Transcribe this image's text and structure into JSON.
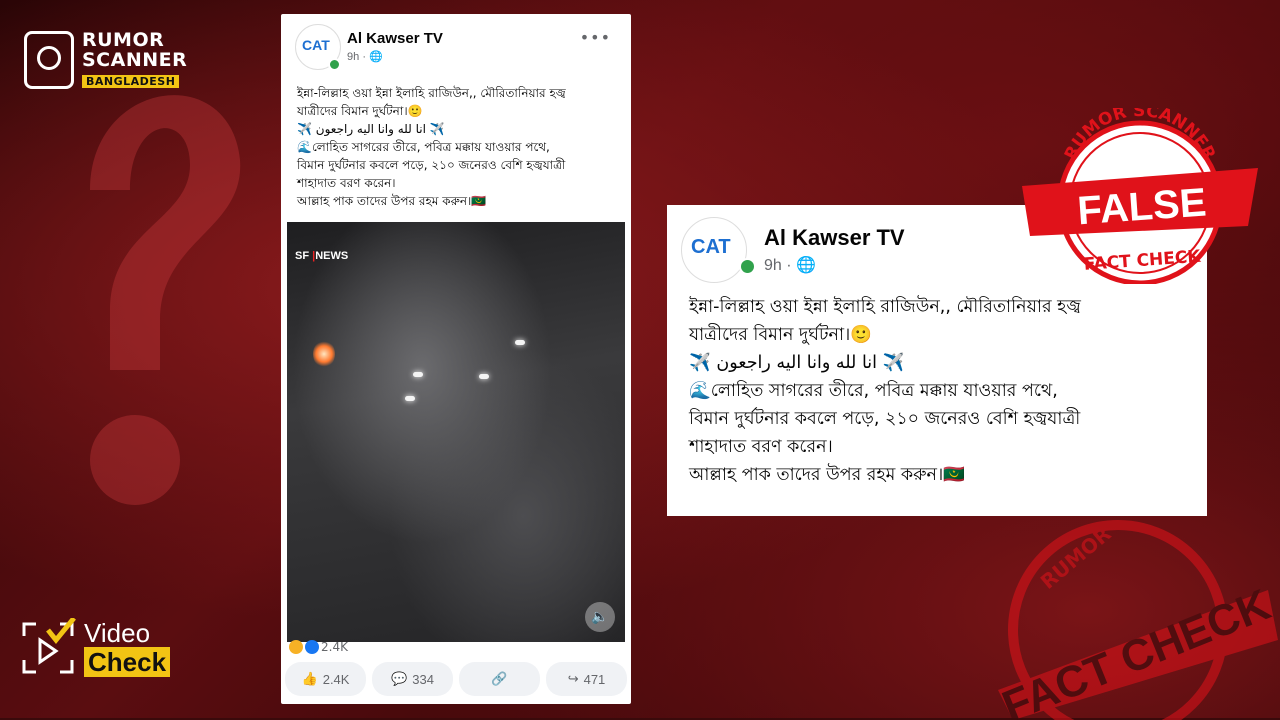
{
  "brand": {
    "line1": "RUMOR",
    "line2": "SCANNER",
    "line3": "BANGLADESH"
  },
  "post": {
    "page_name": "Al Kawser TV",
    "avatar_logo_a": "CA",
    "avatar_logo_b": "T",
    "time": "9h",
    "time_separator": "·",
    "body_lines": [
      "ইন্না-লিল্লাহ ওয়া ইন্না ইলাহি রাজিউন,, মৌরিতানিয়ার হজ্ব",
      "যাত্রীদের বিমান দুর্ঘটনা।🙂",
      "✈️ انا لله وانا اليه راجعون ✈️",
      "🌊লোহিত সাগরের তীরে, পবিত্র মক্কায়  যাওয়ার পথে,",
      "বিমান দুর্ঘটনার কবলে পড়ে, ২১০ জনেরও বেশি হজ্বযাত্রী",
      "শাহাদাত বরণ করেন।",
      "আল্লাহ পাক তাদের উপর রহম করুন।🇲🇷"
    ],
    "video_watermark_a": "SF",
    "video_watermark_b": "NEWS",
    "reaction_count": "2.4K",
    "actions": {
      "like": "2.4K",
      "comment": "334",
      "share": "471"
    }
  },
  "zoom": {
    "page_name": "Al Kawser TV",
    "time": "9h",
    "time_separator": "·",
    "body_lines": [
      "ইন্না-লিল্লাহ ওয়া ইন্না ইলাহি রাজিউন,, মৌরিতানিয়ার হজ্ব",
      "যাত্রীদের বিমান দুর্ঘটনা।🙂",
      "✈️ انا لله وانا اليه راجعون ✈️",
      "🌊লোহিত সাগরের তীরে, পবিত্র মক্কায়  যাওয়ার পথে,",
      "বিমান দুর্ঘটনার কবলে পড়ে, ২১০ জনেরও বেশি হজ্বযাত্রী",
      "শাহাদাত বরণ করেন।",
      "আল্লাহ পাক তাদের উপর রহম করুন।🇲🇷"
    ]
  },
  "stamp": {
    "top": "RUMOR SCANNER",
    "verdict": "FALSE",
    "bottom": "FACT CHECK"
  },
  "bg_stamp": {
    "top": "RUMOR",
    "text": "FACT CHECK"
  },
  "video_check": {
    "line1": "Video",
    "line2": "Check"
  },
  "colors": {
    "accent_yellow": "#f2c414",
    "stamp_red": "#e0121a",
    "bg_red": "#5a0d10",
    "online_green": "#31a24c"
  }
}
